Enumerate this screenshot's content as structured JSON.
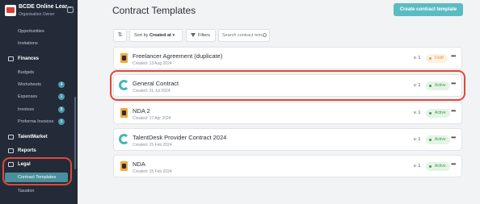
{
  "org": {
    "name": "BCDE Online Lear...",
    "role": "Organisation Owner"
  },
  "sidebar": {
    "items": [
      {
        "label": "Opportunities",
        "type": "sub"
      },
      {
        "label": "Invitations",
        "type": "sub"
      },
      {
        "label": "Finances",
        "type": "head",
        "icon": "finances-icon"
      },
      {
        "label": "Budgets",
        "type": "sub"
      },
      {
        "label": "Worksheets",
        "type": "sub",
        "badge": "4"
      },
      {
        "label": "Expenses",
        "type": "sub",
        "badge": "1"
      },
      {
        "label": "Invoices",
        "type": "sub",
        "badge": "8"
      },
      {
        "label": "Proforma Invoices",
        "type": "sub",
        "badge": "5"
      },
      {
        "label": "TalentMarket",
        "type": "head",
        "icon": "talentmarket-icon"
      },
      {
        "label": "Reports",
        "type": "head",
        "icon": "reports-icon"
      },
      {
        "label": "Legal",
        "type": "head",
        "icon": "legal-icon"
      },
      {
        "label": "Contract Templates",
        "type": "sub",
        "active": true
      },
      {
        "label": "Taxation",
        "type": "sub"
      }
    ]
  },
  "page": {
    "title": "Contract Templates",
    "create_label": "Create contract template"
  },
  "toolbar": {
    "sort_prefix": "Sort by",
    "sort_value": "Created at",
    "filters_label": "Filters",
    "search_placeholder": "Search contract tem..."
  },
  "templates": [
    {
      "name": "Freelancer Agreement (duplicate)",
      "created": "Created: 13 Aug 2024",
      "version": "v. 1",
      "status": "Draft",
      "icon": "document-icon"
    },
    {
      "name": "General Contract",
      "created": "Created: 31 Jul 2024",
      "version": "v. 1",
      "status": "Active",
      "icon": "talentdesk-icon"
    },
    {
      "name": "NDA 2",
      "created": "Created: 17 Apr 2024",
      "version": "v. 1",
      "status": "Active",
      "icon": "document-icon"
    },
    {
      "name": "TalentDesk Provider Contract 2024",
      "created": "Created: 15 Feb 2024",
      "version": "v. 1",
      "status": "Active",
      "icon": "talentdesk-icon"
    },
    {
      "name": "NDA",
      "created": "Created: 15 Feb 2024",
      "version": "v. 1",
      "status": "Active",
      "icon": "document-icon"
    }
  ],
  "colors": {
    "sidebar": "#232b38",
    "accent": "#5bbcc2",
    "active_status": "#3a9a55",
    "draft_status": "#e79a3b",
    "highlight": "#e0483a"
  }
}
